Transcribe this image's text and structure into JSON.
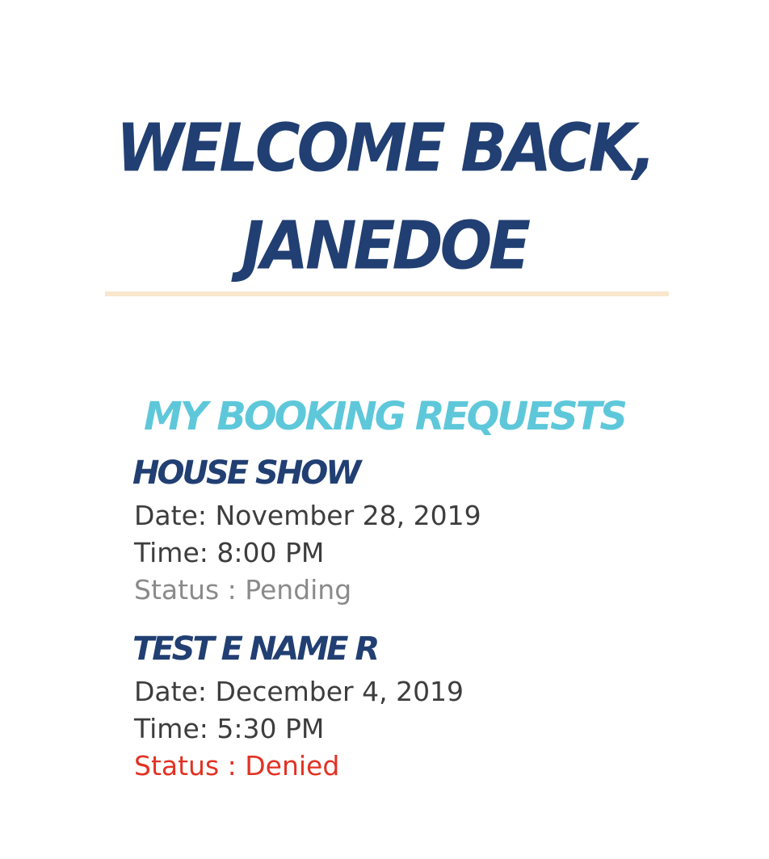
{
  "welcome": {
    "line1": "Welcome Back,",
    "line2": "janedoe"
  },
  "section": {
    "title": "My Booking Requests"
  },
  "bookings": [
    {
      "name": "House Show",
      "date": "Date: November 28, 2019",
      "time": "Time: 8:00 PM",
      "status": "Status : Pending",
      "status_color": "#8a8a8a"
    },
    {
      "name": "Test E Name R",
      "date": "Date: December 4, 2019",
      "time": "Time: 5:30 PM",
      "status": "Status : Denied",
      "status_color": "#e23224"
    }
  ],
  "colors": {
    "primary_navy": "#213f72",
    "accent_cyan": "#5ec8da",
    "divider_cream": "#f8e6cd"
  }
}
